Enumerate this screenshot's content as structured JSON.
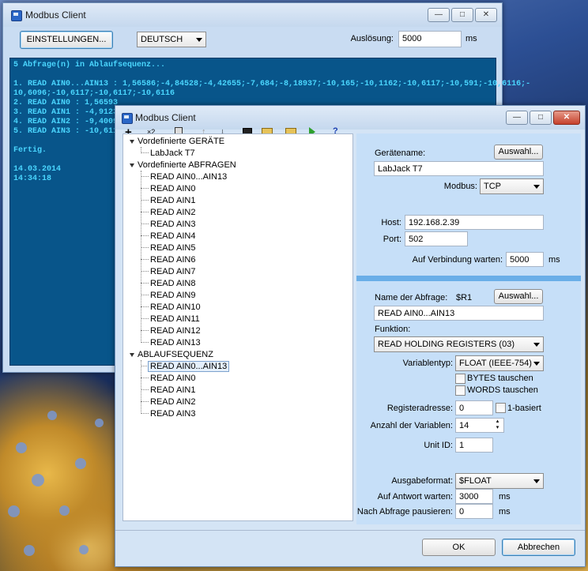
{
  "main_window": {
    "title": "Modbus Client",
    "settings_button": "EINSTELLUNGEN...",
    "language_select": "DEUTSCH",
    "resolution_label": "Auslösung:",
    "resolution_value": "5000",
    "resolution_unit": "ms",
    "console_lines": [
      "5 Abfrage(n) in Ablaufsequenz...",
      "",
      "1. READ AIN0...AIN13 : 1,56586;-4,84528;-4,42655;-7,684;-8,18937;-10,165;-10,1162;-10,6117;-10,591;-10,6116;-",
      "10,6096;-10,6117;-10,6117;-10,6116",
      "2. READ AIN0 : 1,56593",
      "3. READ AIN1 : -4,91234",
      "4. READ AIN2 : -9,40094",
      "5. READ AIN3 : -10,6116",
      "",
      "Fertig.",
      "",
      "14.03.2014",
      "14:34:18"
    ]
  },
  "dialog": {
    "title": "Modbus Client",
    "toolbar": {
      "x2_label": "×2"
    },
    "tree": {
      "devices_header": "Vordefinierte GERÄTE",
      "devices": [
        "LabJack T7"
      ],
      "queries_header": "Vordefinierte ABFRAGEN",
      "queries": [
        "READ AIN0...AIN13",
        "READ AIN0",
        "READ AIN1",
        "READ AIN2",
        "READ AIN3",
        "READ AIN4",
        "READ AIN5",
        "READ AIN6",
        "READ AIN7",
        "READ AIN8",
        "READ AIN9",
        "READ AIN10",
        "READ AIN11",
        "READ AIN12",
        "READ AIN13"
      ],
      "sequence_header": "ABLAUFSEQUENZ",
      "sequence": [
        "READ AIN0...AIN13",
        "READ AIN0",
        "READ AIN1",
        "READ AIN2",
        "READ AIN3"
      ]
    },
    "device": {
      "name_label": "Gerätename:",
      "select_button": "Auswahl...",
      "name_value": "LabJack T7",
      "modbus_label": "Modbus:",
      "modbus_value": "TCP",
      "host_label": "Host:",
      "host_value": "192.168.2.39",
      "port_label": "Port:",
      "port_value": "502",
      "wait_label": "Auf Verbindung warten:",
      "wait_value": "5000",
      "wait_unit": "ms"
    },
    "query": {
      "name_label": "Name der Abfrage:",
      "name_var": "$R1",
      "select_button": "Auswahl...",
      "name_value": "READ AIN0...AIN13",
      "function_label": "Funktion:",
      "function_value": "READ HOLDING REGISTERS (03)",
      "vartype_label": "Variablentyp:",
      "vartype_value": "FLOAT (IEEE-754)",
      "swap_bytes_label": "BYTES tauschen",
      "swap_words_label": "WORDS tauschen",
      "register_label": "Registeradresse:",
      "register_value": "0",
      "one_based_label": "1-basiert",
      "count_label": "Anzahl der Variablen:",
      "count_value": "14",
      "unit_label": "Unit ID:",
      "unit_value": "1",
      "output_label": "Ausgabeformat:",
      "output_value": "$FLOAT",
      "answer_label": "Auf Antwort warten:",
      "answer_value": "3000",
      "answer_unit": "ms",
      "pause_label": "Nach Abfrage pausieren:",
      "pause_value": "0",
      "pause_unit": "ms"
    },
    "ok_button": "OK",
    "cancel_button": "Abbrechen"
  }
}
